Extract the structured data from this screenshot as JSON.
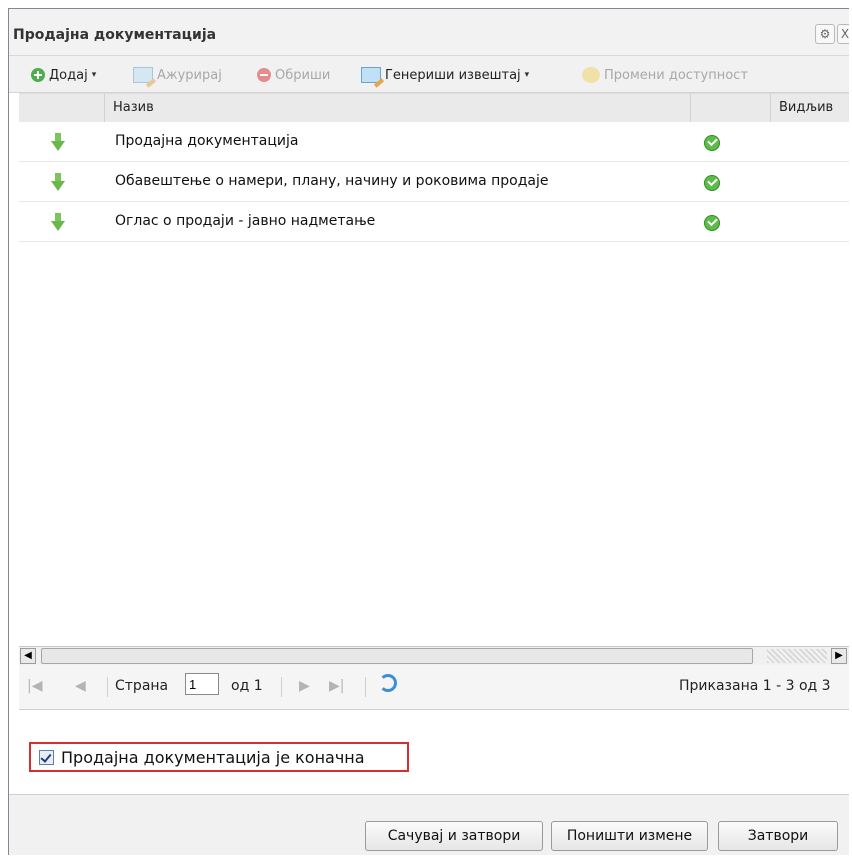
{
  "window": {
    "title": "Продајна документација",
    "controls": {
      "settings_icon": "gear-icon",
      "close_icon": "close-icon",
      "close_label": "X"
    }
  },
  "toolbar": {
    "add_label": "Додај",
    "update_label": "Ажурирај",
    "delete_label": "Обриши",
    "report_label": "Генериши извештај",
    "availability_label": "Промени доступност",
    "caret": "▾"
  },
  "grid": {
    "columns": [
      "Назив",
      "Видљив"
    ],
    "rows": [
      {
        "name": "Продајна документација",
        "visible": true
      },
      {
        "name": "Обавештење о намери, плану, начину и роковима продаје",
        "visible": true
      },
      {
        "name": "Оглас о продаји - јавно надметање",
        "visible": true
      }
    ]
  },
  "scrollbar": {
    "left_arrow": "◀",
    "right_arrow": "▶"
  },
  "pager": {
    "first": "|◀",
    "prev": "◀",
    "page_label": "Страна",
    "page_value": "1",
    "of_label": "од 1",
    "next": "▶",
    "last": "▶|",
    "summary": "Приказана 1 - 3 од 3"
  },
  "final_checkbox": {
    "label": "Продајна документација је коначна",
    "checked": true
  },
  "footer": {
    "save_close": "Сачувај и затвори",
    "cancel_changes": "Поништи измене",
    "close": "Затвори"
  },
  "colors": {
    "accent_red": "#d72f2f",
    "ok_green": "#5cbc4a",
    "arrow_green": "#7cc55e"
  }
}
